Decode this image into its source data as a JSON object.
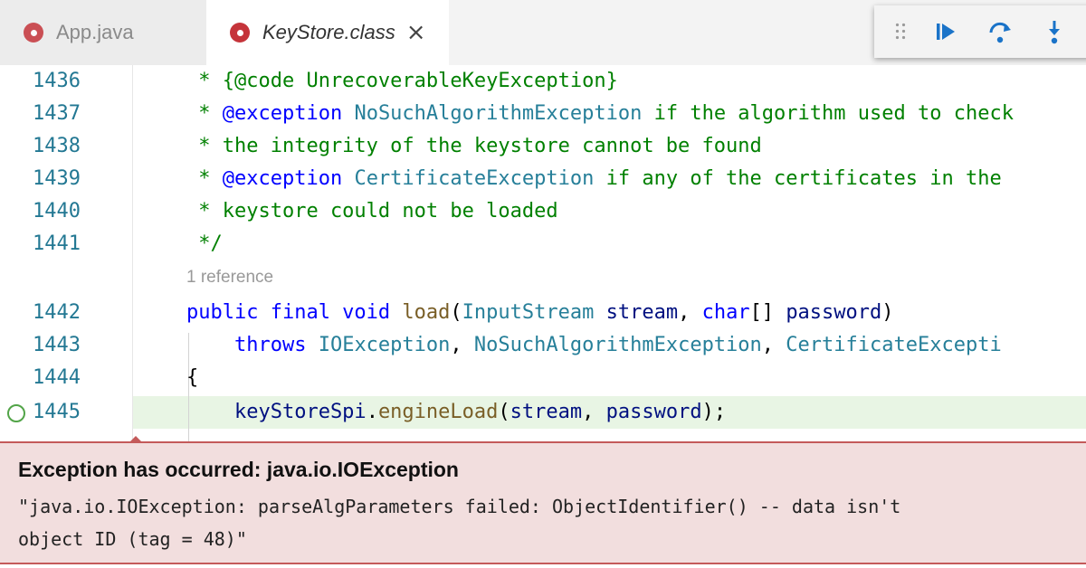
{
  "tabs": [
    {
      "label": "App.java",
      "active": false
    },
    {
      "label": "KeyStore.class",
      "active": true
    }
  ],
  "debug_toolbar": {
    "buttons": [
      "continue-icon",
      "step-over-icon",
      "step-into-icon"
    ]
  },
  "editor": {
    "lines": [
      {
        "num": "1436",
        "segments": [
          {
            "t": " * {@code UnrecoverableKeyException}",
            "c": "comment"
          }
        ]
      },
      {
        "num": "1437",
        "segments": [
          {
            "t": " * ",
            "c": "comment"
          },
          {
            "t": "@exception",
            "c": "tag"
          },
          {
            "t": " NoSuchAlgorithmException",
            "c": "type"
          },
          {
            "t": " if the algorithm used to check",
            "c": "comment"
          }
        ]
      },
      {
        "num": "1438",
        "segments": [
          {
            "t": " * the integrity of the keystore cannot be found",
            "c": "comment"
          }
        ]
      },
      {
        "num": "1439",
        "segments": [
          {
            "t": " * ",
            "c": "comment"
          },
          {
            "t": "@exception",
            "c": "tag"
          },
          {
            "t": " CertificateException",
            "c": "type"
          },
          {
            "t": " if any of the certificates in the",
            "c": "comment"
          }
        ]
      },
      {
        "num": "1440",
        "segments": [
          {
            "t": " * keystore could not be loaded",
            "c": "comment"
          }
        ]
      },
      {
        "num": "1441",
        "segments": [
          {
            "t": " */",
            "c": "comment"
          }
        ]
      },
      {
        "num": "1442",
        "segments": [
          {
            "t": "public final void ",
            "c": "kw"
          },
          {
            "t": "load",
            "c": "fn"
          },
          {
            "t": "(",
            "c": "plain"
          },
          {
            "t": "InputStream",
            "c": "type"
          },
          {
            "t": " stream",
            "c": "var"
          },
          {
            "t": ", ",
            "c": "plain"
          },
          {
            "t": "char",
            "c": "kw"
          },
          {
            "t": "[] ",
            "c": "plain"
          },
          {
            "t": "password",
            "c": "var"
          },
          {
            "t": ")",
            "c": "plain"
          }
        ]
      },
      {
        "num": "1443",
        "segments": [
          {
            "t": "    throws ",
            "c": "kw"
          },
          {
            "t": "IOException",
            "c": "type"
          },
          {
            "t": ", ",
            "c": "plain"
          },
          {
            "t": "NoSuchAlgorithmException",
            "c": "type"
          },
          {
            "t": ", ",
            "c": "plain"
          },
          {
            "t": "CertificateExcepti",
            "c": "type"
          }
        ]
      },
      {
        "num": "1444",
        "segments": [
          {
            "t": "{",
            "c": "plain"
          }
        ]
      },
      {
        "num": "1445",
        "segments": [
          {
            "t": "    keyStoreSpi",
            "c": "var"
          },
          {
            "t": ".",
            "c": "plain"
          },
          {
            "t": "engineLoad",
            "c": "fn"
          },
          {
            "t": "(",
            "c": "plain"
          },
          {
            "t": "stream",
            "c": "var"
          },
          {
            "t": ", ",
            "c": "plain"
          },
          {
            "t": "password",
            "c": "var"
          },
          {
            "t": ");",
            "c": "plain"
          }
        ]
      }
    ],
    "codelens": "1 reference"
  },
  "exception": {
    "title": "Exception has occurred: java.io.IOException",
    "message_line1": "\"java.io.IOException: parseAlgParameters failed: ObjectIdentifier() -- data isn't",
    "message_line2": "object ID (tag = 48)\""
  },
  "colors": {
    "comment": "#008000",
    "keyword": "#0000ff",
    "type": "#267f99",
    "function": "#795e26",
    "variable": "#001080",
    "line_number": "#237893",
    "exception_bg": "#f2dede",
    "exception_border": "#c45a5a"
  }
}
